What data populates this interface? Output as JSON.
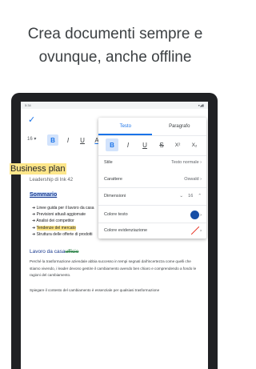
{
  "headline": {
    "line1": "Crea documenti sempre e",
    "line2": "ovunque, anche offline"
  },
  "status_bar": {
    "time": "5:34",
    "icons": "▾◢▮"
  },
  "toolbar": {
    "font_size": "16",
    "bold": "B",
    "italic": "I",
    "underline": "U",
    "text_color": "A",
    "check_icon": "✓"
  },
  "document": {
    "title": "Business plan",
    "subtitle": "Leadership di Ink 42",
    "summary_heading": "Sommario",
    "bullets": [
      "Linee guida per il lavoro da casa",
      "Previsioni attuali aggiornate",
      "Analisi dei competitor",
      "Tendenze del mercato",
      "Struttura delle offerte di prodotti"
    ],
    "section_heading_prefix": "Lavoro da casa",
    "section_heading_strike": "ufficio",
    "paragraph": "Perché la trasformazione aziendale abbia successo in tempi segnati dall'incertezza come quelli che stiamo vivendo, i leader devono gestire il cambiamento avendo ben chiaro e comprendendo a fondo le ragioni del cambiamento.",
    "paragraph2": "Spiegare il contesto del cambiamento è essenziale per qualsiasi trasformazione"
  },
  "panel": {
    "tabs": [
      "Testo",
      "Paragrafo"
    ],
    "format_buttons": [
      "B",
      "I",
      "U",
      "S",
      "X²",
      "X₂"
    ],
    "style_label": "Stile",
    "style_value": "Testo normale",
    "font_label": "Carattere",
    "font_value": "Oswald",
    "size_label": "Dimensioni",
    "size_value": "16",
    "text_color_label": "Colore testo",
    "highlight_label": "Colore evidenziazione"
  },
  "colors": {
    "accent": "#1a73e8",
    "highlight": "#fde68a",
    "text_color_swatch": "#174ea6"
  }
}
